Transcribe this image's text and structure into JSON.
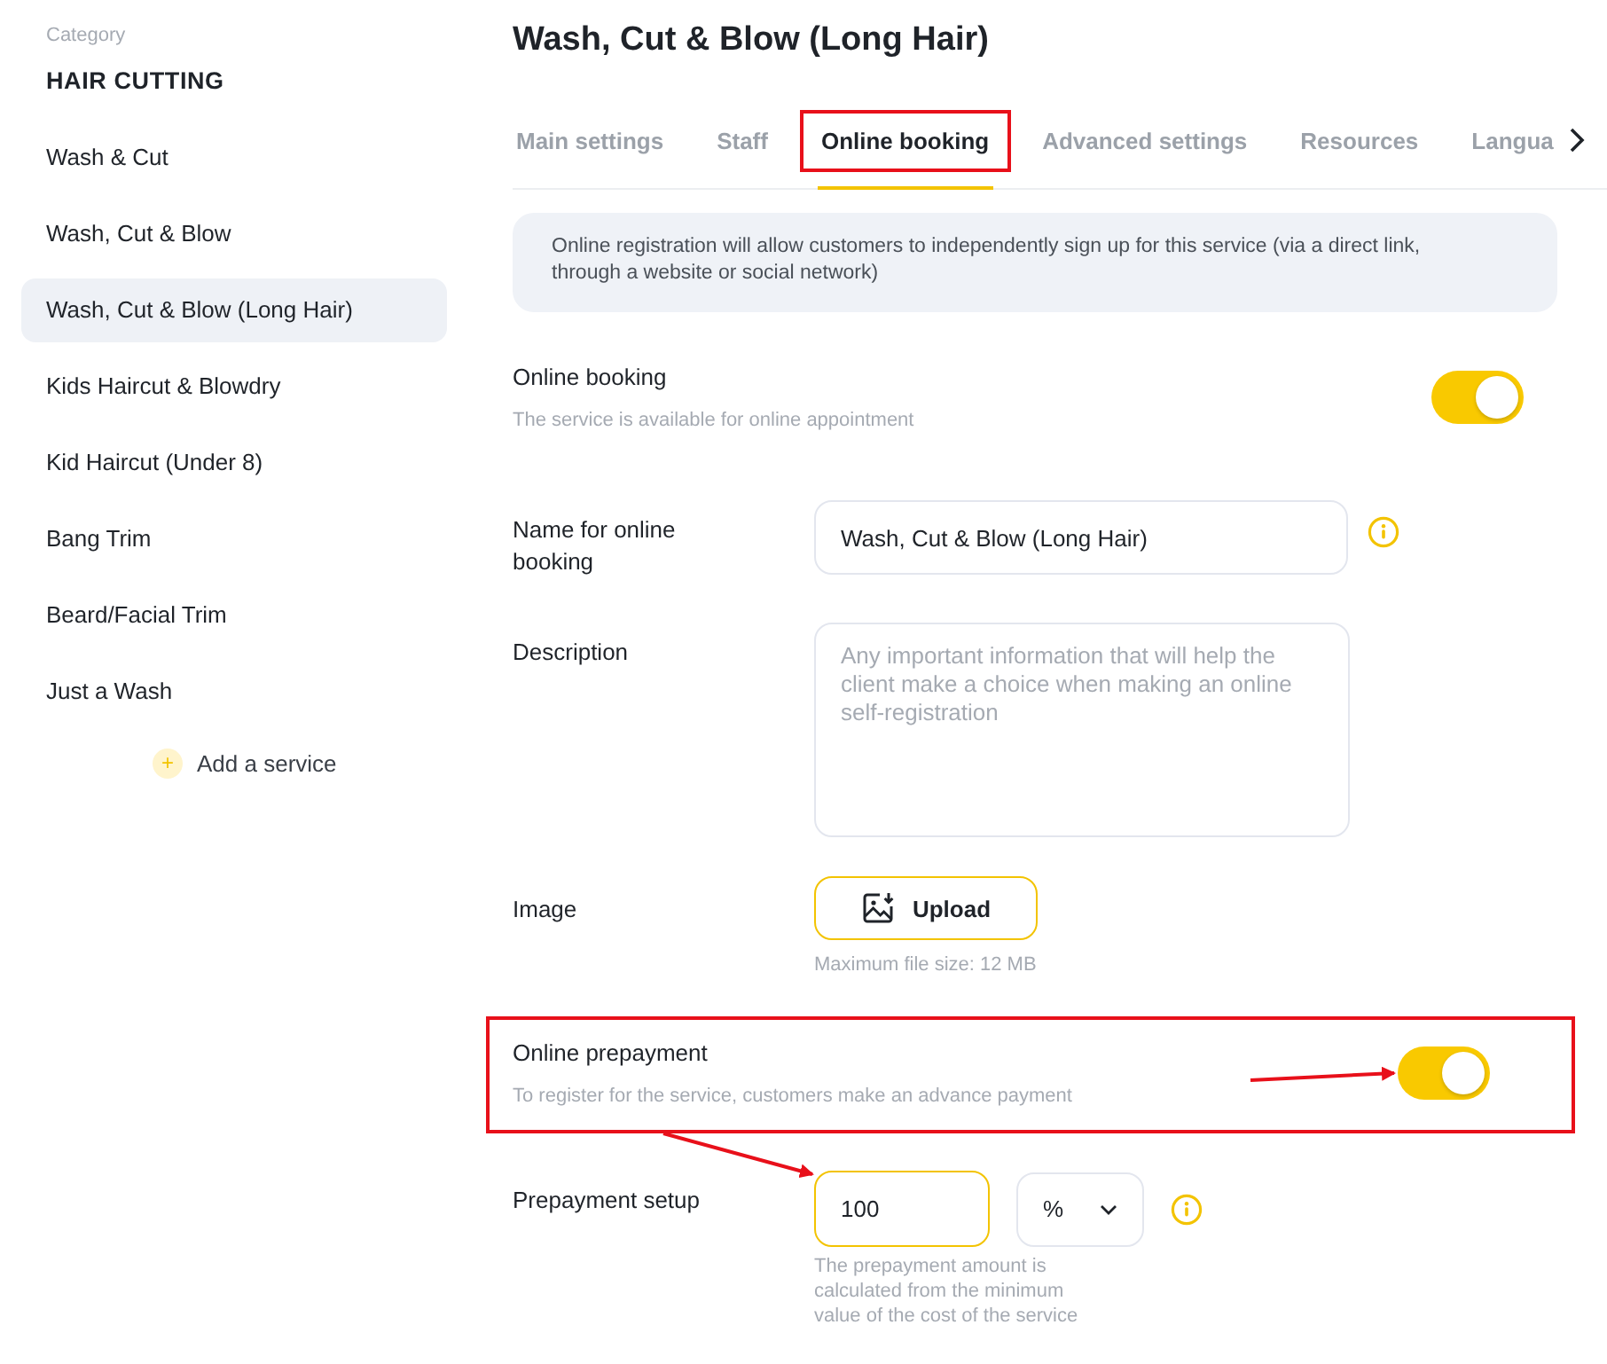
{
  "sidebar": {
    "caption": "Category",
    "category": "HAIR CUTTING",
    "items": [
      {
        "label": "Wash & Cut",
        "selected": false
      },
      {
        "label": "Wash, Cut & Blow",
        "selected": false
      },
      {
        "label": "Wash, Cut & Blow (Long Hair)",
        "selected": true
      },
      {
        "label": "Kids Haircut & Blowdry",
        "selected": false
      },
      {
        "label": "Kid Haircut (Under 8)",
        "selected": false
      },
      {
        "label": "Bang Trim",
        "selected": false
      },
      {
        "label": "Beard/Facial Trim",
        "selected": false
      },
      {
        "label": "Just a Wash",
        "selected": false
      }
    ],
    "add_button": {
      "icon": "+",
      "label": "Add a service"
    }
  },
  "title": "Wash, Cut & Blow (Long Hair)",
  "tabs": [
    {
      "label": "Main settings",
      "selected": false,
      "highlighted": false
    },
    {
      "label": "Staff",
      "selected": false,
      "highlighted": false
    },
    {
      "label": "Online booking",
      "selected": true,
      "highlighted": true
    },
    {
      "label": "Advanced settings",
      "selected": false,
      "highlighted": false
    },
    {
      "label": "Resources",
      "selected": false,
      "highlighted": false
    },
    {
      "label": "Langua",
      "selected": false,
      "highlighted": false
    }
  ],
  "info_note": "Online registration will allow customers to independently sign up for this service (via a direct link, through a website or social network)",
  "online_booking": {
    "label": "Online booking",
    "hint": "The service is available for online appointment",
    "on": true
  },
  "name_field": {
    "label": "Name for online booking",
    "value": "Wash, Cut & Blow (Long Hair)"
  },
  "description_field": {
    "label": "Description",
    "placeholder": "Any important information that will help the client make a choice when making an online self-registration"
  },
  "image": {
    "label": "Image",
    "button": "Upload",
    "hint": "Maximum file size: 12 MB"
  },
  "online_prepayment": {
    "label": "Online prepayment",
    "hint": "To register for the service, customers make an advance payment",
    "on": true,
    "highlighted": true
  },
  "prepayment_setup": {
    "label": "Prepayment setup",
    "value": "100",
    "unit": "%",
    "hint": "The prepayment amount is calculated from the minimum value of the cost of the service"
  }
}
